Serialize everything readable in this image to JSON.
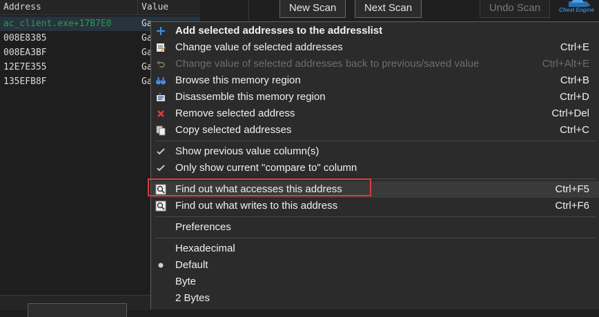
{
  "address_list": {
    "columns": {
      "address": "Address",
      "value": "Value"
    },
    "rows": [
      {
        "address": "ac_client.exe+17B7E0",
        "value": "Ga",
        "selected": true
      },
      {
        "address": "008E8385",
        "value": "Ga"
      },
      {
        "address": "008EA3BF",
        "value": "Ga"
      },
      {
        "address": "12E7E355",
        "value": "Ga"
      },
      {
        "address": "135EFB8F",
        "value": "Ga"
      }
    ]
  },
  "toolbar": {
    "new_scan": "New Scan",
    "next_scan": "Next Scan",
    "undo_scan": "Undo Scan",
    "logo_text": "Cheat Engine"
  },
  "context_menu": {
    "items": [
      {
        "label": "Add selected addresses to the addresslist",
        "shortcut": "",
        "icon": "plus-icon"
      },
      {
        "label": "Change value of selected addresses",
        "shortcut": "Ctrl+E",
        "icon": "edit-icon"
      },
      {
        "label": "Change value of selected addresses back to previous/saved value",
        "shortcut": "Ctrl+Alt+E",
        "icon": "undo-icon"
      },
      {
        "label": "Browse this memory region",
        "shortcut": "Ctrl+B",
        "icon": "binoculars-icon"
      },
      {
        "label": "Disassemble this memory region",
        "shortcut": "Ctrl+D",
        "icon": "disassemble-icon"
      },
      {
        "label": "Remove selected address",
        "shortcut": "Ctrl+Del",
        "icon": "remove-icon"
      },
      {
        "label": "Copy selected addresses",
        "shortcut": "Ctrl+C",
        "icon": "copy-icon"
      },
      {
        "label": "Show previous value column(s)",
        "shortcut": "",
        "icon": "check-icon"
      },
      {
        "label": "Only show current \"compare to\" column",
        "shortcut": "",
        "icon": "check-icon"
      },
      {
        "label": "Find out what accesses this address",
        "shortcut": "Ctrl+F5",
        "icon": "magnifier-icon"
      },
      {
        "label": "Find out what writes to this address",
        "shortcut": "Ctrl+F6",
        "icon": "magnifier-icon"
      },
      {
        "label": "Preferences",
        "shortcut": ""
      },
      {
        "label": "Hexadecimal",
        "shortcut": ""
      },
      {
        "label": "Default",
        "shortcut": "",
        "icon": "radio-dot-icon"
      },
      {
        "label": "Byte",
        "shortcut": ""
      },
      {
        "label": "2 Bytes",
        "shortcut": ""
      }
    ]
  }
}
